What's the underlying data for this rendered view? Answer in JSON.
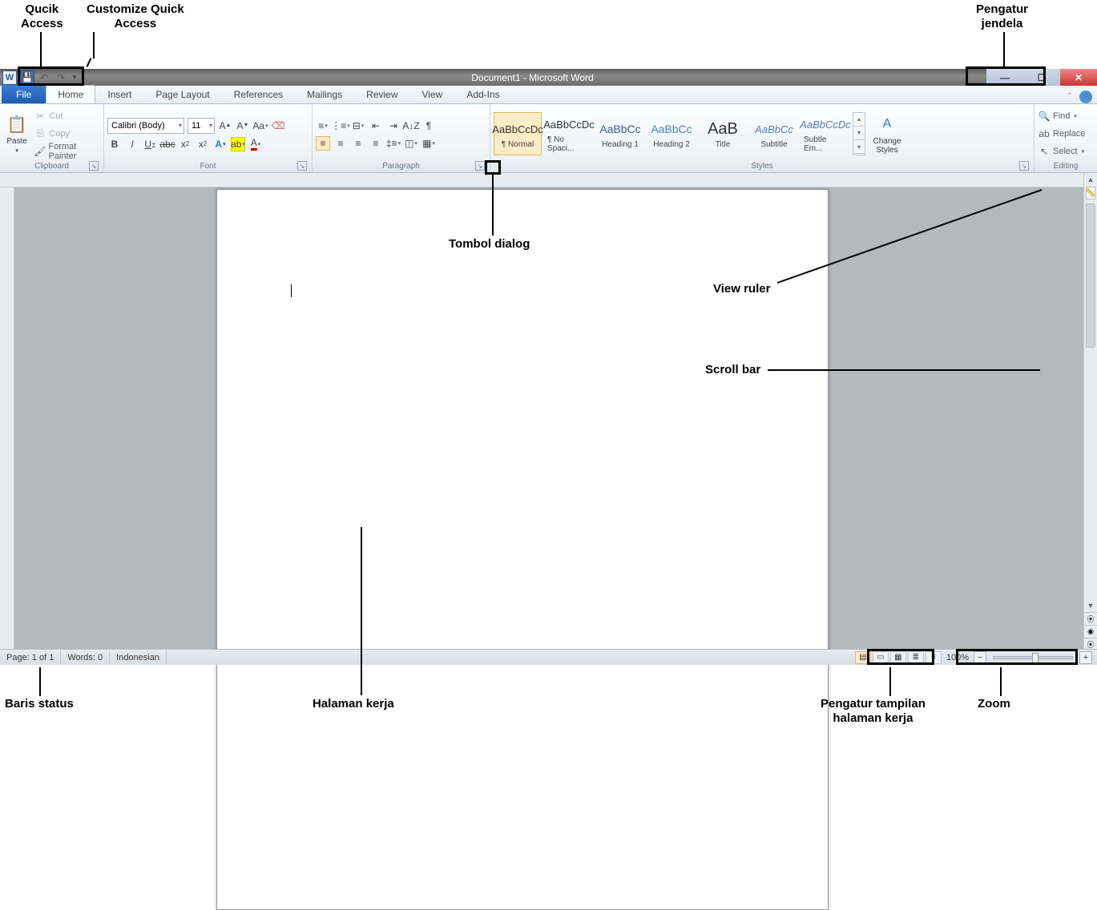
{
  "annotations": {
    "quick_access": "Qucik\nAccess",
    "customize_qa": "Customize Quick\nAccess",
    "pengatur_jendela": "Pengatur\njendela",
    "tombol_dialog": "Tombol dialog",
    "view_ruler": "View ruler",
    "scroll_bar": "Scroll bar",
    "baris_status": "Baris status",
    "halaman_kerja": "Halaman kerja",
    "pengatur_tampilan": "Pengatur tampilan\nhalaman kerja",
    "zoom": "Zoom"
  },
  "titlebar": {
    "title": "Document1 - Microsoft Word",
    "app_letter": "W"
  },
  "tabs": {
    "file": "File",
    "home": "Home",
    "insert": "Insert",
    "page_layout": "Page Layout",
    "references": "References",
    "mailings": "Mailings",
    "review": "Review",
    "view": "View",
    "addins": "Add-Ins"
  },
  "clipboard": {
    "paste": "Paste",
    "cut": "Cut",
    "copy": "Copy",
    "format_painter": "Format Painter",
    "label": "Clipboard"
  },
  "font": {
    "name": "Calibri (Body)",
    "size": "11",
    "label": "Font"
  },
  "paragraph": {
    "label": "Paragraph"
  },
  "styles": {
    "label": "Styles",
    "normal": "¶ Normal",
    "no_spacing": "¶ No Spaci...",
    "heading1": "Heading 1",
    "heading2": "Heading 2",
    "title": "Title",
    "subtitle": "Subtitle",
    "subtle_em": "Subtle Em...",
    "preview": "AaBbCcDc",
    "preview_h": "AaBbCc",
    "preview_t": "AaB",
    "change": "Change\nStyles"
  },
  "editing": {
    "label": "Editing",
    "find": "Find",
    "replace": "Replace",
    "select": "Select"
  },
  "status": {
    "page": "Page: 1 of 1",
    "words": "Words: 0",
    "lang": "Indonesian",
    "zoom": "100%"
  }
}
